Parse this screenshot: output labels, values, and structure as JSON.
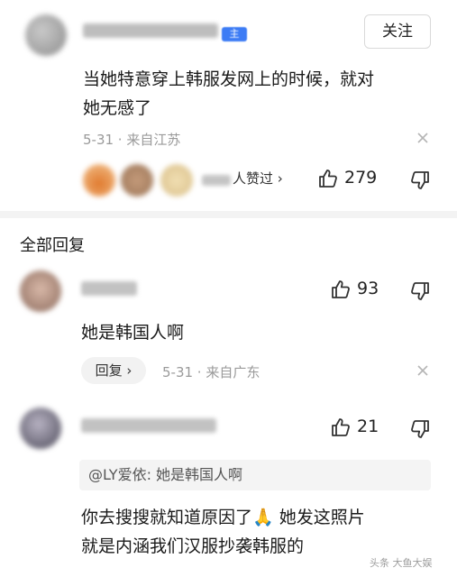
{
  "top_comment": {
    "author_badge": "主",
    "follow_label": "关注",
    "text_line1": "当她特意穿上韩服发网上的时候，就对",
    "text_line2": "她无感了",
    "meta": "5-31 · 来自江苏",
    "likers_suffix": "人赞过 ›",
    "like_count": "279"
  },
  "replies_section": {
    "title": "全部回复",
    "replies": [
      {
        "text": "她是韩国人啊",
        "like_count": "93",
        "reply_label": "回复 ›",
        "meta": "5-31 · 来自广东"
      },
      {
        "like_count": "21",
        "quote": "@LY爱依:  她是韩国人啊",
        "text_line1": "你去搜搜就知道原因了🙏 她发这照片",
        "text_line2": "就是内涵我们汉服抄袭韩服的"
      }
    ]
  },
  "watermark": "头条 大鱼大娱",
  "icons": [
    "close-icon",
    "thumbs-up-icon",
    "thumbs-down-icon",
    "chevron-right-icon"
  ],
  "colors": {
    "muted_text": "#9a9a9a",
    "divider": "#f3f3f3",
    "badge_blue": "#3d7cf5"
  }
}
